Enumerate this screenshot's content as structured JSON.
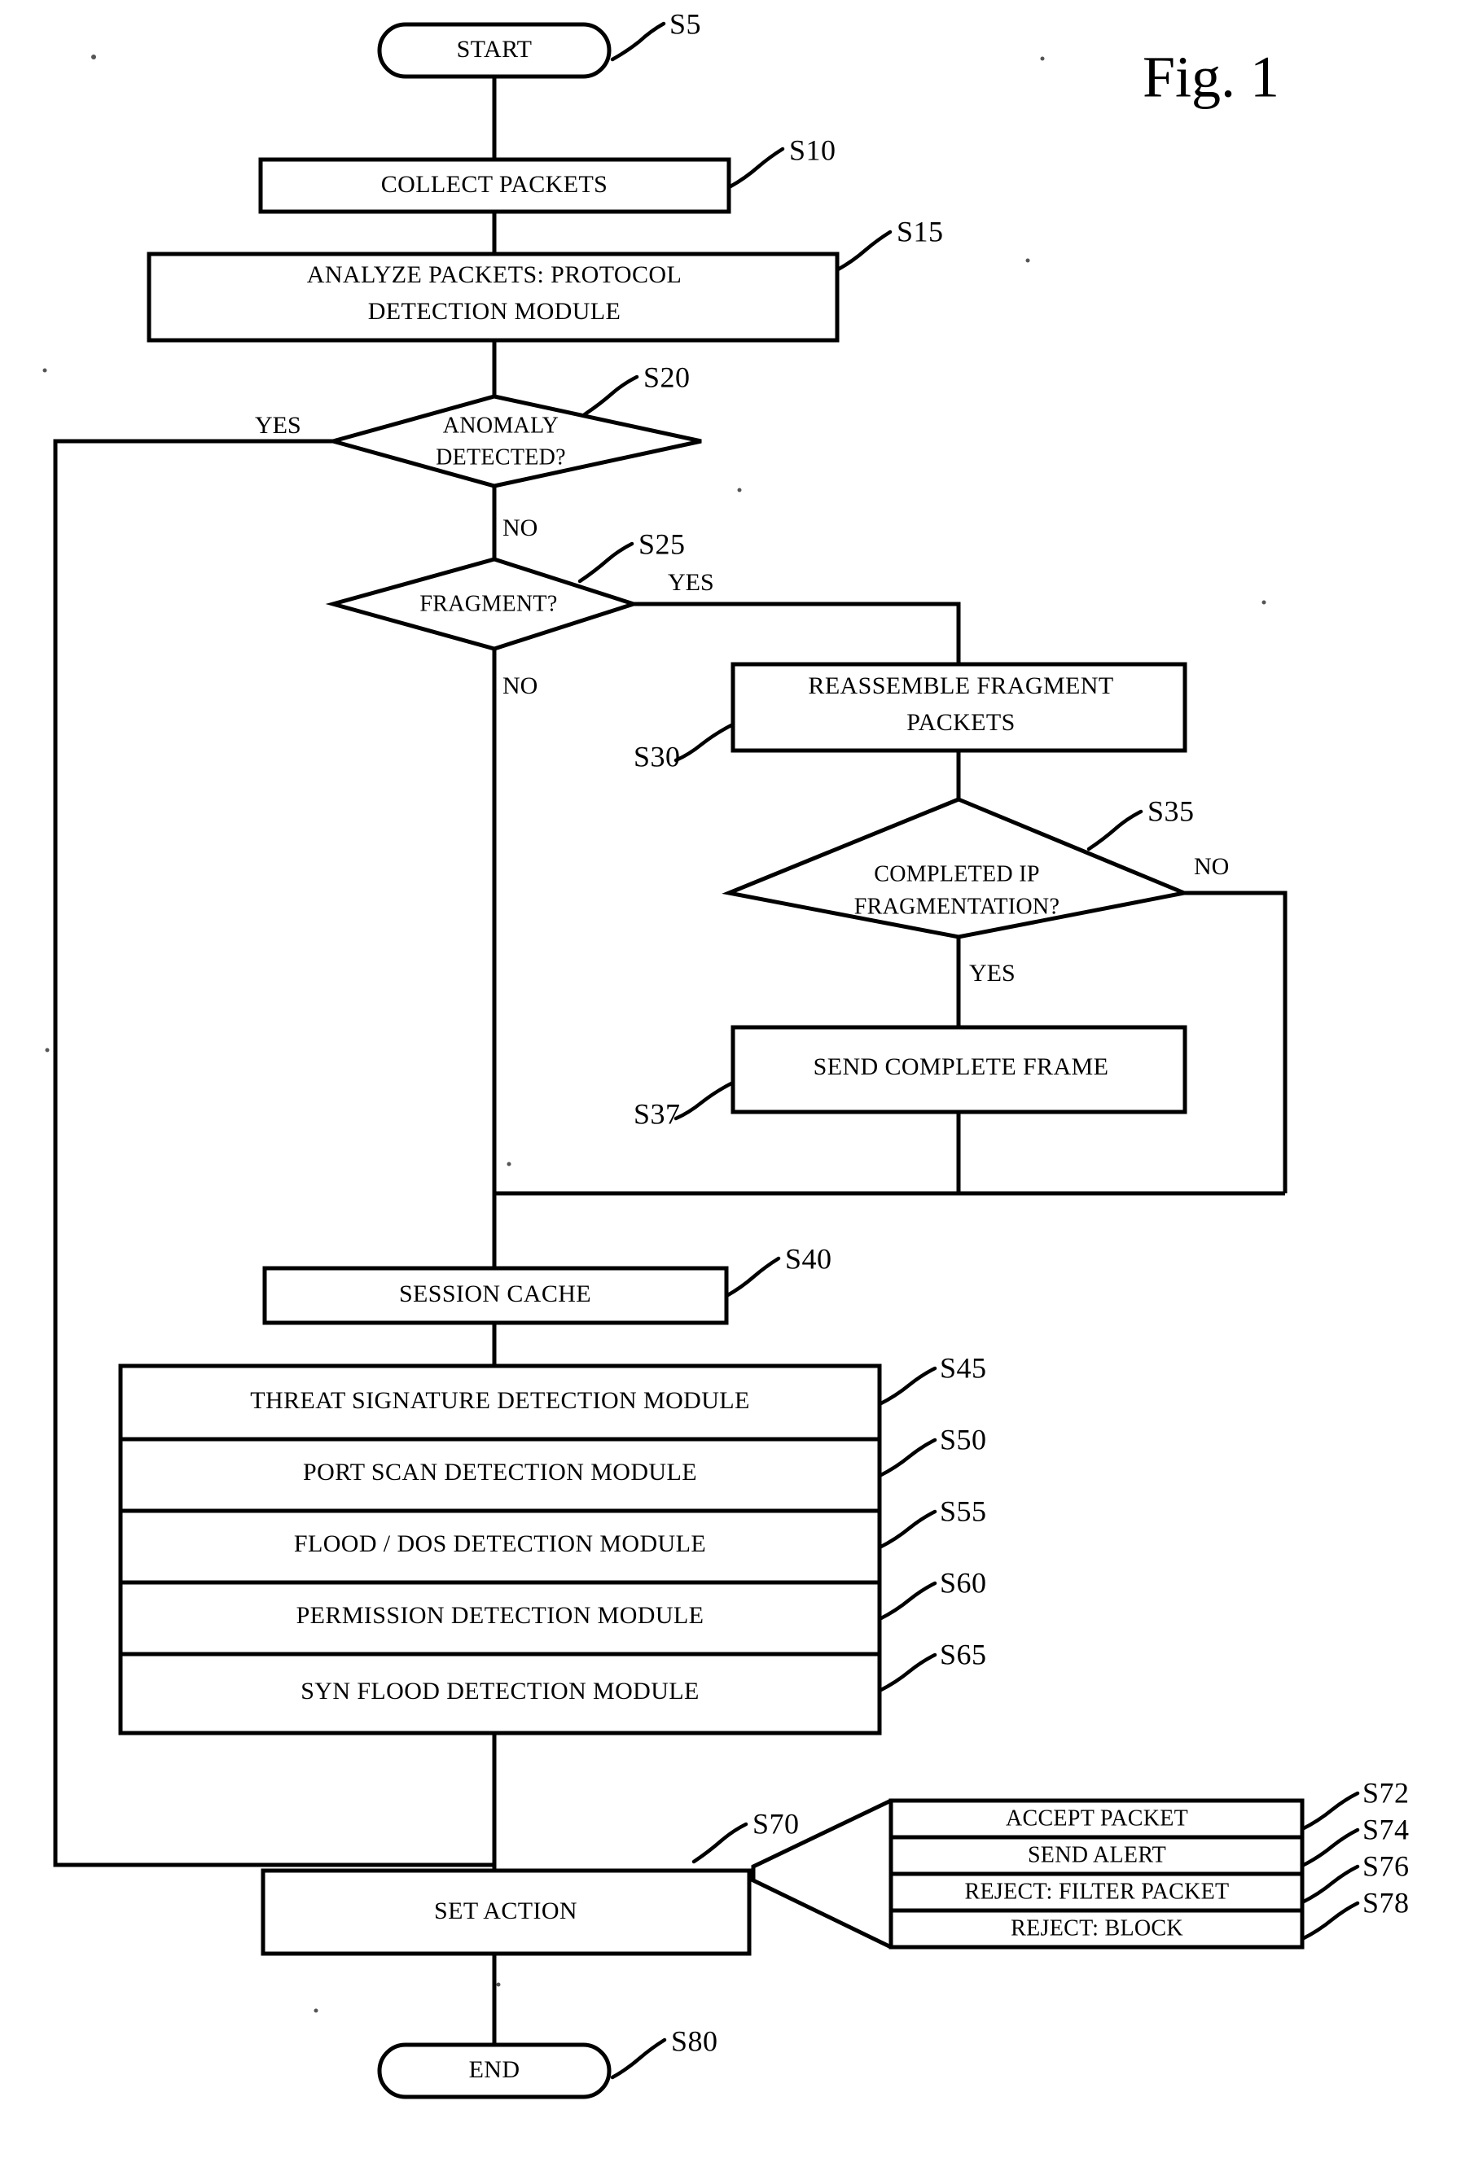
{
  "figure": {
    "title": "Fig. 1",
    "type": "flowchart"
  },
  "nodes": {
    "start": {
      "label": "START",
      "ref": "S5",
      "shape": "terminator"
    },
    "collect": {
      "label": "COLLECT PACKETS",
      "ref": "S10",
      "shape": "process"
    },
    "analyze_l1": {
      "label": "ANALYZE PACKETS: PROTOCOL",
      "ref": "S15",
      "shape": "process"
    },
    "analyze_l2": {
      "label": "DETECTION MODULE"
    },
    "anomaly_l1": {
      "label": "ANOMALY",
      "ref": "S20",
      "shape": "decision"
    },
    "anomaly_l2": {
      "label": "DETECTED?"
    },
    "fragment": {
      "label": "FRAGMENT?",
      "ref": "S25",
      "shape": "decision"
    },
    "reasm_l1": {
      "label": "REASSEMBLE FRAGMENT",
      "ref": "S30",
      "shape": "process"
    },
    "reasm_l2": {
      "label": "PACKETS"
    },
    "completed_l1": {
      "label": "COMPLETED IP",
      "ref": "S35",
      "shape": "decision"
    },
    "completed_l2": {
      "label": "FRAGMENTATION?"
    },
    "send_frame": {
      "label": "SEND COMPLETE FRAME",
      "ref": "S37",
      "shape": "process"
    },
    "session": {
      "label": "SESSION CACHE",
      "ref": "S40",
      "shape": "process"
    },
    "set_action": {
      "label": "SET ACTION",
      "ref": "S70",
      "shape": "process"
    },
    "end": {
      "label": "END",
      "ref": "S80",
      "shape": "terminator"
    }
  },
  "detection_modules": [
    {
      "label": "THREAT SIGNATURE DETECTION MODULE",
      "ref": "S45"
    },
    {
      "label": "PORT SCAN DETECTION MODULE",
      "ref": "S50"
    },
    {
      "label": "FLOOD / DOS DETECTION MODULE",
      "ref": "S55"
    },
    {
      "label": "PERMISSION DETECTION MODULE",
      "ref": "S60"
    },
    {
      "label": "SYN FLOOD DETECTION MODULE",
      "ref": "S65"
    }
  ],
  "actions": [
    {
      "label": "ACCEPT PACKET",
      "ref": "S72"
    },
    {
      "label": "SEND ALERT",
      "ref": "S74"
    },
    {
      "label": "REJECT: FILTER PACKET",
      "ref": "S76"
    },
    {
      "label": "REJECT: BLOCK",
      "ref": "S78"
    }
  ],
  "branch_labels": {
    "anomaly_yes": "YES",
    "anomaly_no": "NO",
    "fragment_yes": "YES",
    "fragment_no": "NO",
    "completed_yes": "YES",
    "completed_no": "NO"
  },
  "colors": {
    "ink": "#000000",
    "paper": "#ffffff"
  }
}
